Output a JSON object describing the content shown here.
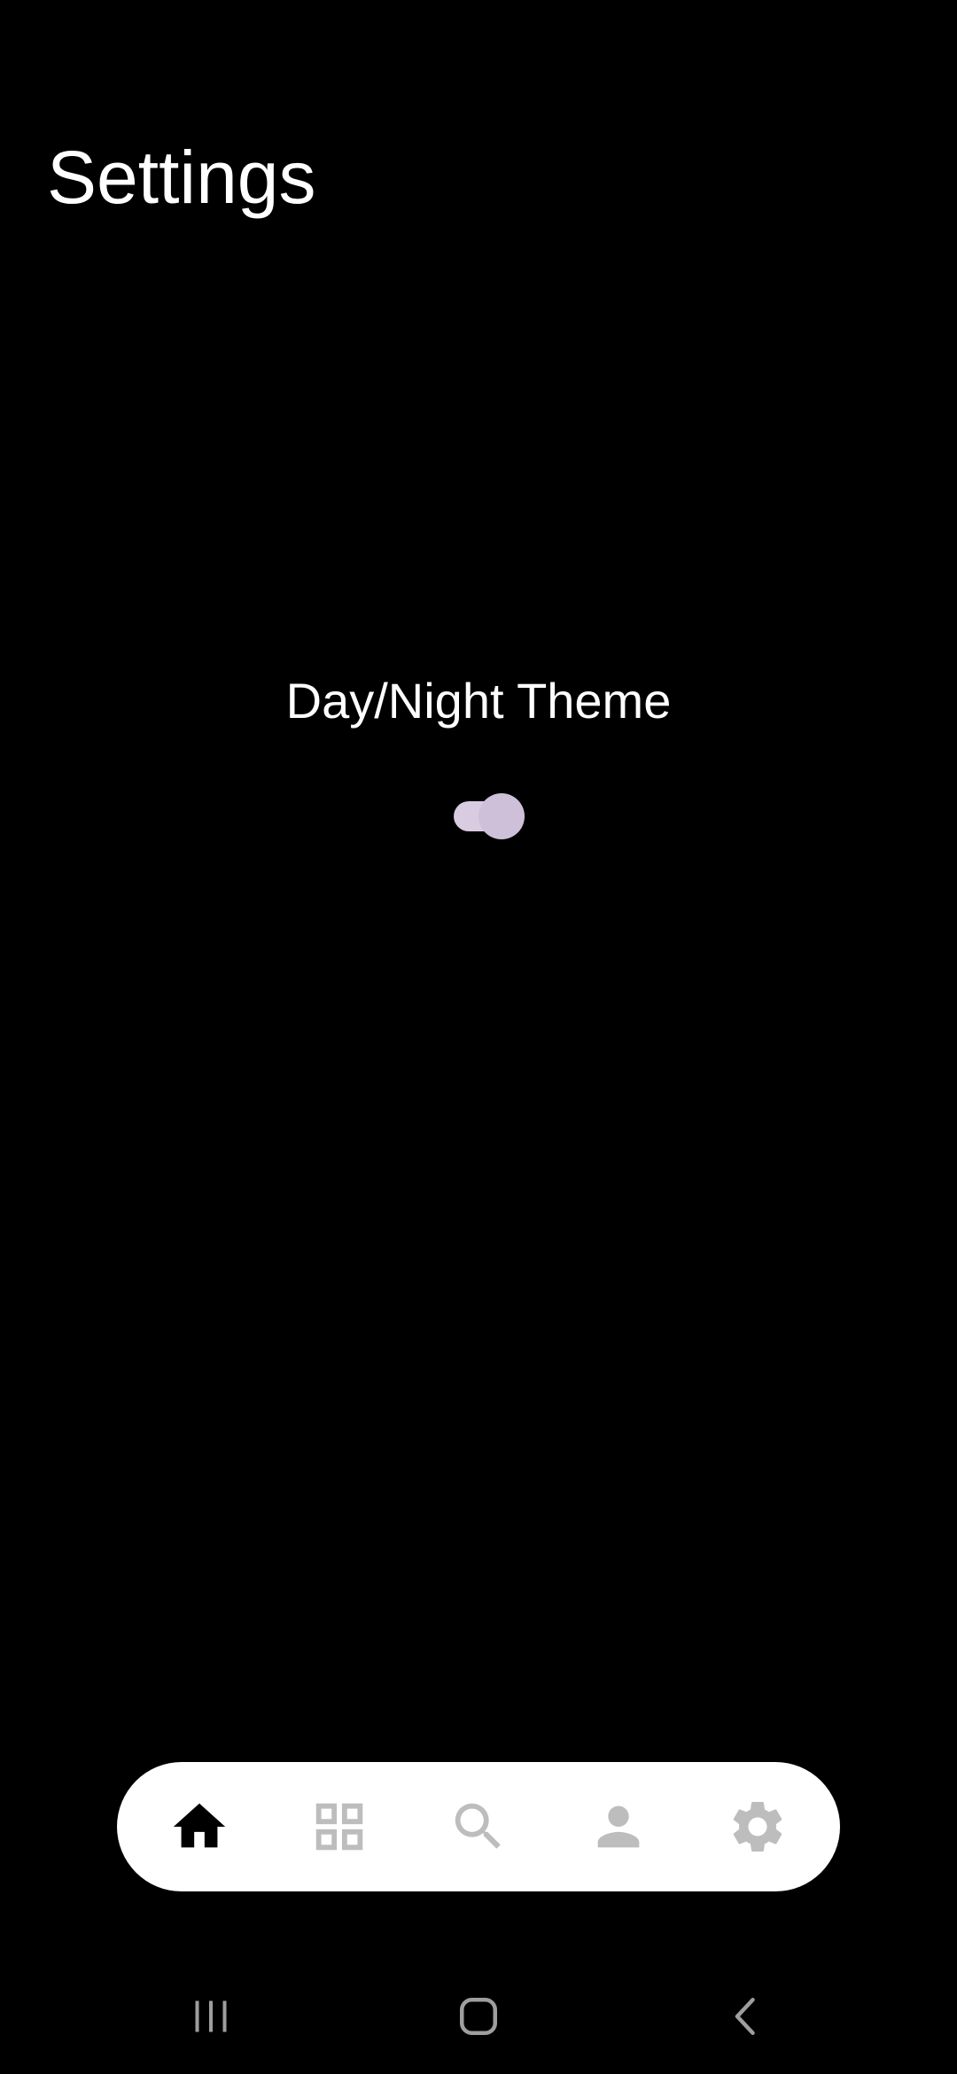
{
  "header": {
    "title": "Settings"
  },
  "theme": {
    "label": "Day/Night Theme",
    "toggle_on": true
  },
  "bottom_nav": {
    "items": [
      {
        "icon": "home-icon",
        "active": true
      },
      {
        "icon": "grid-icon",
        "active": false
      },
      {
        "icon": "search-icon",
        "active": false
      },
      {
        "icon": "person-icon",
        "active": false
      },
      {
        "icon": "gear-icon",
        "active": false
      }
    ]
  },
  "system_nav": {
    "items": [
      {
        "icon": "recents-icon"
      },
      {
        "icon": "home-outline-icon"
      },
      {
        "icon": "back-chevron-icon"
      }
    ]
  },
  "colors": {
    "background": "#000000",
    "text": "#ffffff",
    "toggle_track": "#d9cbe0",
    "toggle_thumb": "#cfc0da",
    "nav_background": "#ffffff",
    "nav_active_icon": "#000000",
    "nav_inactive_icon": "#bdbdbd",
    "system_icon": "#9e9e9e"
  }
}
